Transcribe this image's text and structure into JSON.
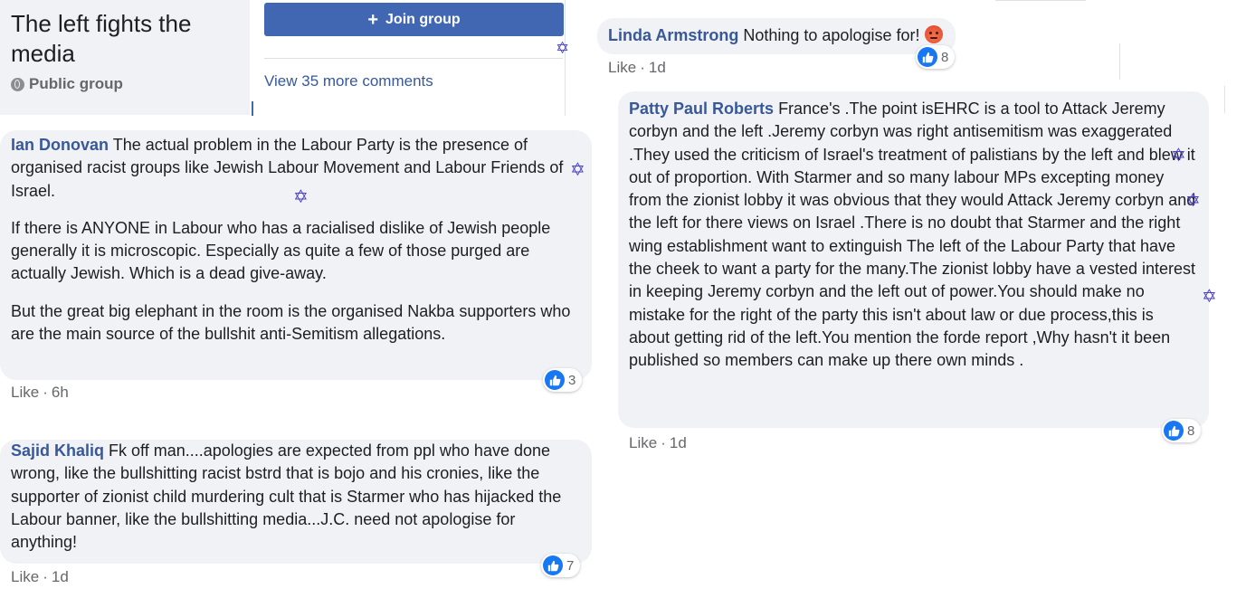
{
  "group": {
    "title": "The left fights the media",
    "privacy": "Public group",
    "join_label": "Join group",
    "view_more": "View 35 more comments"
  },
  "comments": [
    {
      "author": "Ian Donovan",
      "paragraphs": [
        "The actual problem in the Labour Party is the presence of organised racist groups like Jewish Labour Movement and Labour Friends of Israel.",
        "If there is ANYONE in Labour who has a racialised dislike of Jewish people generally it is microscopic. Especially as quite a few of those purged are actually Jewish. Which is a dead give-away.",
        "But the great big elephant in the room is the organised Nakba supporters who are the main source of the bullshit anti-Semitism allegations."
      ],
      "like_label": "Like",
      "time": "6h",
      "reactions": "3"
    },
    {
      "author": "Sajid Khaliq",
      "text": "Fk off man....apologies are expected from ppl who have done wrong, like the bullshitting racist bstrd that is bojo and his cronies, like the supporter of zionist child murdering cult that is Starmer who has hijacked the Labour banner, like the bullshitting media...J.C. need not apologise for anything!",
      "like_label": "Like",
      "time": "1d",
      "reactions": "7"
    },
    {
      "author": "Linda Armstrong",
      "text": "Nothing to apologise for!",
      "like_label": "Like",
      "time": "1d",
      "reactions": "8"
    },
    {
      "author": "Patty Paul Roberts",
      "text": "France's .The point isEHRC is a tool to Attack Jeremy corbyn and the left .Jeremy corbyn was right antisemitism was exaggerated .They used the criticism of Israel's treatment of palistians by the left and blew it out of proportion. With Starmer and so many labour MPs excepting money from the zionist lobby it was obvious that they would Attack Jeremy corbyn and the left for there views on Israel .There is no doubt that Starmer and the right wing establishment want to extinguish The left of the Labour Party that have the cheek to want a party for the many.The zionist lobby have a vested interest in keeping Jeremy corbyn and the left out of power.You should make no mistake for the right of the party this isn't about law or due process,this is about getting rid of the left.You mention the forde report ,Why hasn't it been published so members can make up there own minds .",
      "like_label": "Like",
      "time": "1d",
      "reactions": "8"
    }
  ],
  "icons": {
    "like": "thumbs-up-icon",
    "angry": "angry-emoji-icon",
    "globe": "globe-icon",
    "star": "star-of-david-icon"
  },
  "colors": {
    "accent": "#4267b2",
    "author": "#385898",
    "like": "#1877f2",
    "bubble": "#f0f2f5",
    "star": "#4a3fd0"
  }
}
